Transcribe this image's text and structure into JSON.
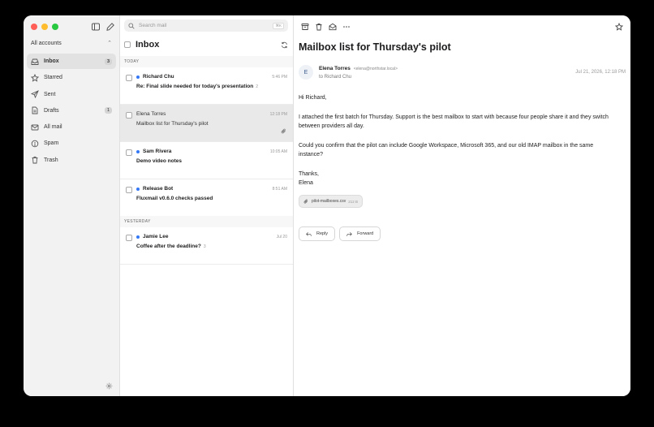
{
  "sidebar": {
    "account": "All accounts",
    "items": [
      {
        "label": "Inbox",
        "count": "3",
        "icon": "inbox-icon"
      },
      {
        "label": "Starred",
        "count": "",
        "icon": "star-icon"
      },
      {
        "label": "Sent",
        "count": "",
        "icon": "send-icon"
      },
      {
        "label": "Drafts",
        "count": "1",
        "icon": "draft-icon"
      },
      {
        "label": "All mail",
        "count": "",
        "icon": "mail-icon"
      },
      {
        "label": "Spam",
        "count": "",
        "icon": "spam-icon"
      },
      {
        "label": "Trash",
        "count": "",
        "icon": "trash-icon"
      }
    ]
  },
  "list": {
    "search_placeholder": "Search mail",
    "search_shortcut": "⌘K",
    "title": "Inbox",
    "groups": {
      "today": "Today",
      "yesterday": "Yesterday"
    },
    "messages": [
      {
        "from": "Richard Chu",
        "time": "5:46 PM",
        "subject": "Re: Final slide needed for today's presentation",
        "thread_count": "2",
        "unread": true
      },
      {
        "from": "Elena Torres",
        "time": "12:18 PM",
        "subject": "Mailbox list for Thursday's pilot",
        "thread_count": "",
        "unread": false,
        "selected": true,
        "attachment": true
      },
      {
        "from": "Sam Rivera",
        "time": "10:05 AM",
        "subject": "Demo video notes",
        "thread_count": "",
        "unread": true
      },
      {
        "from": "Release Bot",
        "time": "8:51 AM",
        "subject": "Fluxmail v0.6.0 checks passed",
        "thread_count": "",
        "unread": true
      },
      {
        "from": "Jamie Lee",
        "time": "Jul 20",
        "subject": "Coffee after the deadline?",
        "thread_count": "3",
        "unread": true
      }
    ]
  },
  "reader": {
    "subject": "Mailbox list for Thursday's pilot",
    "avatar_initial": "E",
    "sender_name": "Elena Torres",
    "sender_email": "<elena@northstar.local>",
    "to": "to Richard Chu",
    "date": "Jul 21, 2026, 12:18 PM",
    "greeting": "Hi Richard,",
    "paragraph1": "I attached the first batch for Thursday. Support is the best mailbox to start with because four people share it and they switch between providers all day.",
    "paragraph2": "Could you confirm that the pilot can include Google Workspace, Microsoft 365, and our old IMAP mailbox in the same instance?",
    "closing": "Thanks,",
    "signature": "Elena",
    "attachment_name": "pilot-mailboxes.csv",
    "attachment_size": "212 B",
    "reply_label": "Reply",
    "forward_label": "Forward"
  },
  "colors": {
    "accent": "#3478f6",
    "selected_row": "#e9e9e9",
    "sidebar_bg": "#f2f2f2"
  }
}
